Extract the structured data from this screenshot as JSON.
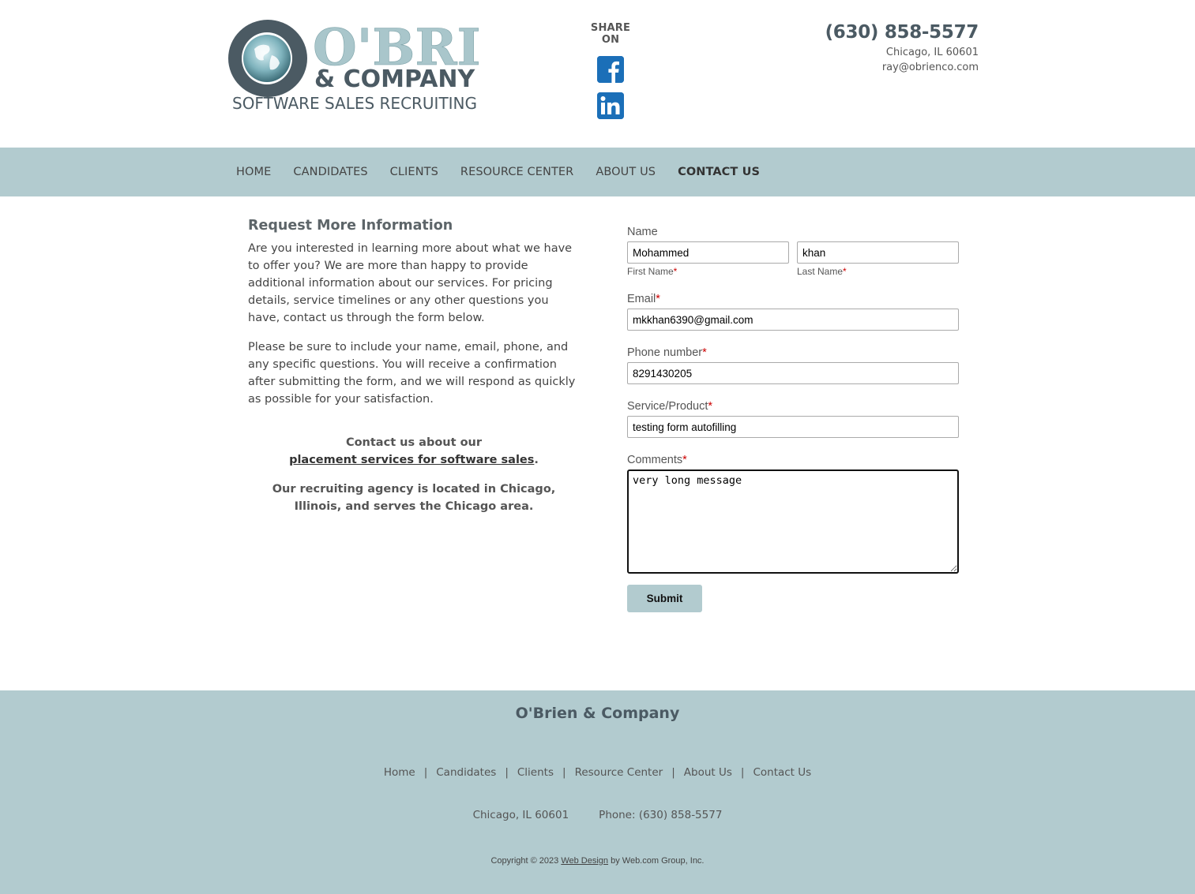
{
  "header": {
    "logo_text": {
      "name": "O'BRIEN",
      "company": "& COMPANY",
      "tagline": "SOFTWARE SALES RECRUITING"
    },
    "share_label": "SHARE ON",
    "phone": "(630) 858-5577",
    "city": "Chicago, IL 60601",
    "email": "ray@obrienco.com"
  },
  "nav": {
    "items": [
      "HOME",
      "CANDIDATES",
      "CLIENTS",
      "RESOURCE CENTER",
      "ABOUT US",
      "CONTACT US"
    ],
    "active": "CONTACT US"
  },
  "intro": {
    "title": "Request More Information",
    "para1": "Are you interested in learning more about what we have to offer you? We are more than happy to provide additional information about our services. For pricing details, service timelines or any other questions you have, contact us through the form below.",
    "para2": "Please be sure to include your name, email, phone, and any specific questions. You will receive a confirmation after submitting the form, and we will respond as quickly as possible for your satisfaction.",
    "contact_line": "Contact us about our",
    "contact_link": "placement services for software sales",
    "contact_period": ".",
    "location": "Our recruiting agency is located in Chicago, Illinois, and serves the Chicago area."
  },
  "form": {
    "name_label": "Name",
    "first_name_value": "Mohammed",
    "first_name_label": "First Name",
    "last_name_value": "khan",
    "last_name_label": "Last Name",
    "email_label": "Email",
    "email_value": "mkkhan6390@gmail.com",
    "phone_label": "Phone number",
    "phone_value": "8291430205",
    "service_label": "Service/Product",
    "service_value": "testing form autofilling",
    "comments_label": "Comments",
    "comments_value": "very long message",
    "required_mark": "*",
    "submit_label": "Submit"
  },
  "footer": {
    "title": "O'Brien & Company",
    "links": [
      "Home",
      "Candidates",
      "Clients",
      "Resource Center",
      "About Us",
      "Contact Us"
    ],
    "separator": "|",
    "city": "Chicago, IL 60601",
    "phone": "Phone: (630) 858-5577",
    "copyright_prefix": "Copyright © 2023 ",
    "copyright_link": "Web Design",
    "copyright_suffix": " by Web.com Group, Inc."
  },
  "colors": {
    "nav_bg": "#b2cbcf",
    "social_blue": "#1b6fb8",
    "required": "#cc0000"
  }
}
